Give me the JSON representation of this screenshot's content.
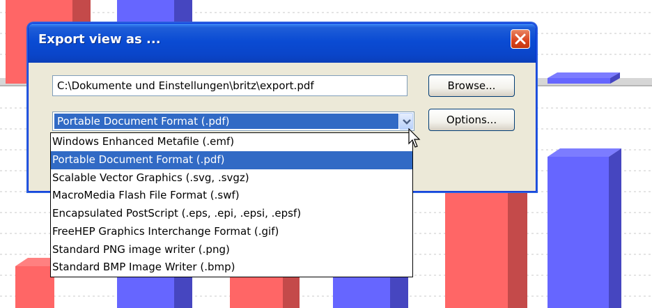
{
  "dialog": {
    "title": "Export view as ...",
    "file_path": "C:\\Dokumente und Einstellungen\\britz\\export.pdf",
    "browse_label": "Browse...",
    "options_label": "Options...",
    "format_selected": "Portable Document Format (.pdf)"
  },
  "dropdown": {
    "options": [
      "Windows Enhanced Metafile (.emf)",
      "Portable Document Format (.pdf)",
      "Scalable Vector Graphics (.svg, .svgz)",
      "MacroMedia Flash File Format (.swf)",
      "Encapsulated PostScript (.eps, .epi, .epsi, .epsf)",
      "FreeHEP Graphics Interchange Format (.gif)",
      "Standard PNG image writer (.png)",
      "Standard BMP Image Writer (.bmp)"
    ],
    "selected_index": 1
  },
  "colors": {
    "bar_red": "#ff6666",
    "bar_red_side": "#c44a4a",
    "bar_blue": "#6666ff",
    "bar_blue_side": "#4646c0",
    "selection": "#316ac5",
    "titlebar": "#0a4bd3"
  }
}
